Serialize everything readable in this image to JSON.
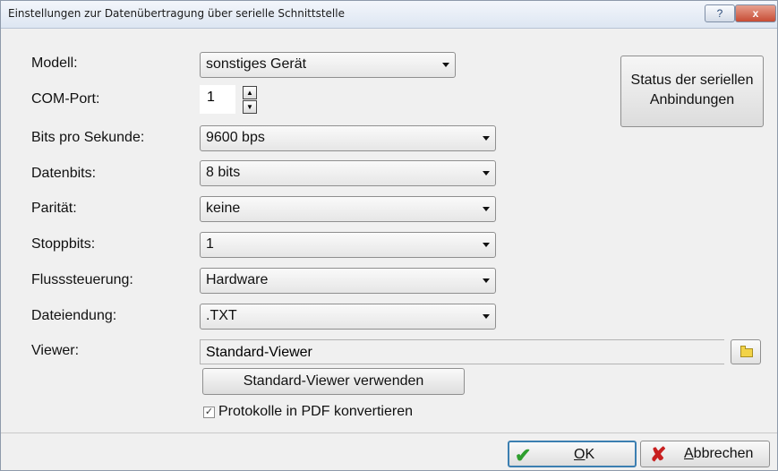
{
  "window": {
    "title": "Einstellungen zur Datenübertragung über serielle Schnittstelle",
    "help_glyph": "?",
    "close_glyph": "x"
  },
  "form": {
    "modell_label": "Modell:",
    "modell_value": "sonstiges Gerät",
    "com_label": "COM-Port:",
    "com_value": "1",
    "bits_label": "Bits pro Sekunde:",
    "bits_value": "9600 bps",
    "datenbits_label": "Datenbits:",
    "datenbits_value": "8 bits",
    "paritat_label": "Parität:",
    "paritat_value": "keine",
    "stoppbits_label": "Stoppbits:",
    "stoppbits_value": "1",
    "fluss_label": "Flusssteuerung:",
    "fluss_value": "Hardware",
    "datei_label": "Dateiendung:",
    "datei_value": ".TXT",
    "viewer_label": "Viewer:",
    "viewer_value": "Standard-Viewer",
    "std_viewer_button": "Standard-Viewer verwenden",
    "pdf_checkbox_label": "Protokolle in PDF konvertieren",
    "pdf_checked": true
  },
  "status_button": {
    "line1": "Status der seriellen",
    "line2": "Anbindungen"
  },
  "buttons": {
    "ok_mnemonic": "O",
    "ok_rest": "K",
    "cancel_mnemonic": "A",
    "cancel_rest": "bbrechen"
  },
  "colors": {
    "ok_icon": "#2e9e2e",
    "cancel_icon": "#c82020",
    "close_button": "#c74c35"
  }
}
